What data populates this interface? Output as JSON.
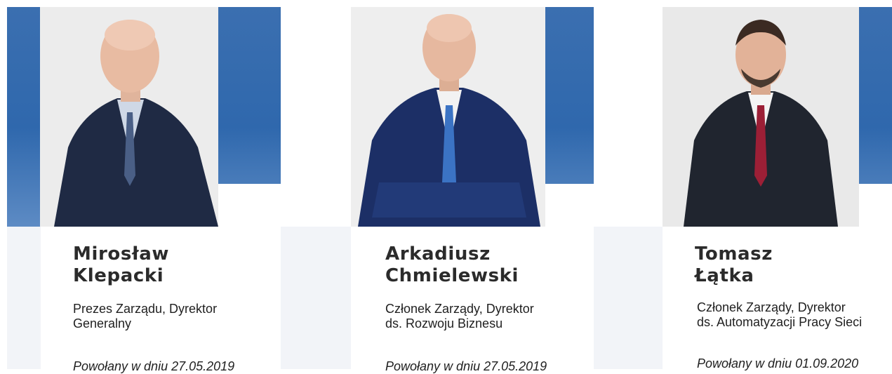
{
  "colors": {
    "accent_blue": "#2f68ad",
    "light_panel": "#f2f4f8",
    "name_text": "#2b2b2b",
    "body_text": "#1f1f1f"
  },
  "members": [
    {
      "name_line1": "Mirosław",
      "name_line2": "Klepacki",
      "role_line1": "Prezes Zarządu, Dyrektor",
      "role_line2": "Generalny",
      "appointed": "Powołany w dniu 27.05.2019",
      "photo": "portrait-photo"
    },
    {
      "name_line1": "Arkadiusz",
      "name_line2": "Chmielewski",
      "role_line1": "Członek Zarządy, Dyrektor",
      "role_line2": "ds. Rozwoju Biznesu",
      "appointed": "Powołany w dniu 27.05.2019",
      "photo": "portrait-photo"
    },
    {
      "name_line1": "Tomasz",
      "name_line2": "Łątka",
      "role_line1": "Członek Zarządy, Dyrektor",
      "role_line2": "ds. Automatyzacji Pracy Sieci",
      "appointed": "Powołany w dniu 01.09.2020",
      "photo": "portrait-photo"
    }
  ]
}
